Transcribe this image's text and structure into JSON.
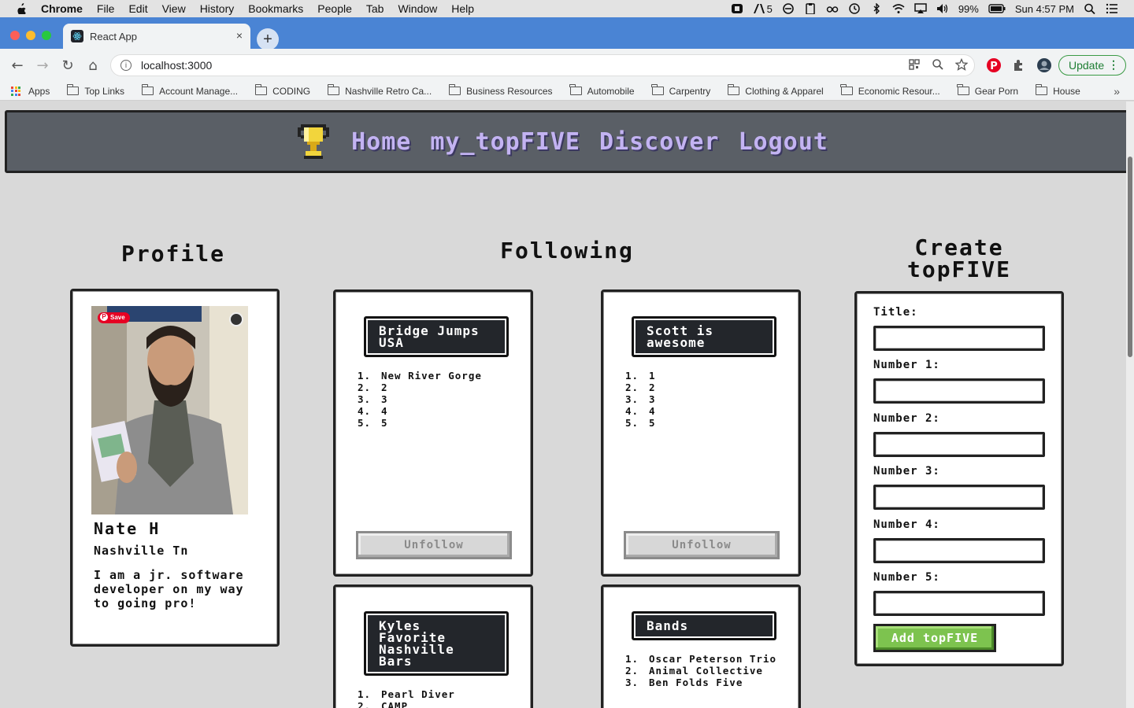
{
  "menubar": {
    "app": "Chrome",
    "items": [
      "File",
      "Edit",
      "View",
      "History",
      "Bookmarks",
      "People",
      "Tab",
      "Window",
      "Help"
    ],
    "badge": "5",
    "battery": "99%",
    "clock": "Sun 4:57 PM"
  },
  "tab": {
    "title": "React App",
    "close": "×"
  },
  "newtab": "+",
  "address": {
    "url": "localhost:3000"
  },
  "toolbar": {
    "update_label": "Update"
  },
  "bookmarks": {
    "apps": "Apps",
    "items": [
      "Top Links",
      "Account Manage...",
      "CODING",
      "Nashville Retro Ca...",
      "Business Resources",
      "Automobile",
      "Carpentry",
      "Clothing & Apparel",
      "Economic Resour...",
      "Gear Porn",
      "House"
    ],
    "more": "»"
  },
  "nav": {
    "links": [
      "Home",
      "my_topFIVE",
      "Discover",
      "Logout"
    ]
  },
  "headings": {
    "profile": "Profile",
    "following": "Following",
    "create_line1": "Create",
    "create_line2": "topFIVE"
  },
  "profile": {
    "save_badge": "Save",
    "name": "Nate H",
    "location": "Nashville Tn",
    "bio": "I am a jr. software developer on my way to going pro!"
  },
  "lists": [
    {
      "title": "Bridge Jumps USA",
      "items": [
        "New River Gorge",
        "2",
        "3",
        "4",
        "5"
      ],
      "action": "Unfollow"
    },
    {
      "title": "Scott is awesome",
      "items": [
        "1",
        "2",
        "3",
        "4",
        "5"
      ],
      "action": "Unfollow"
    },
    {
      "title": "Kyles Favorite Nashville Bars",
      "items": [
        "Pearl Diver",
        "CAMP"
      ]
    },
    {
      "title": "Bands",
      "items": [
        "Oscar Peterson Trio",
        "Animal Collective",
        "Ben Folds Five"
      ]
    }
  ],
  "list_numbers": [
    "1.",
    "2.",
    "3.",
    "4.",
    "5."
  ],
  "form": {
    "labels": [
      "Title:",
      "Number 1:",
      "Number 2:",
      "Number 3:",
      "Number 4:",
      "Number 5:"
    ],
    "values": [
      "",
      "",
      "",
      "",
      "",
      ""
    ],
    "submit": "Add topFIVE"
  },
  "colors": {
    "nav_bg": "#5a5f66",
    "nav_link": "#c3b3f2",
    "list_title_bg": "#23262b",
    "add_button": "#7dc34f",
    "chrome_accent": "#4a84d4"
  }
}
